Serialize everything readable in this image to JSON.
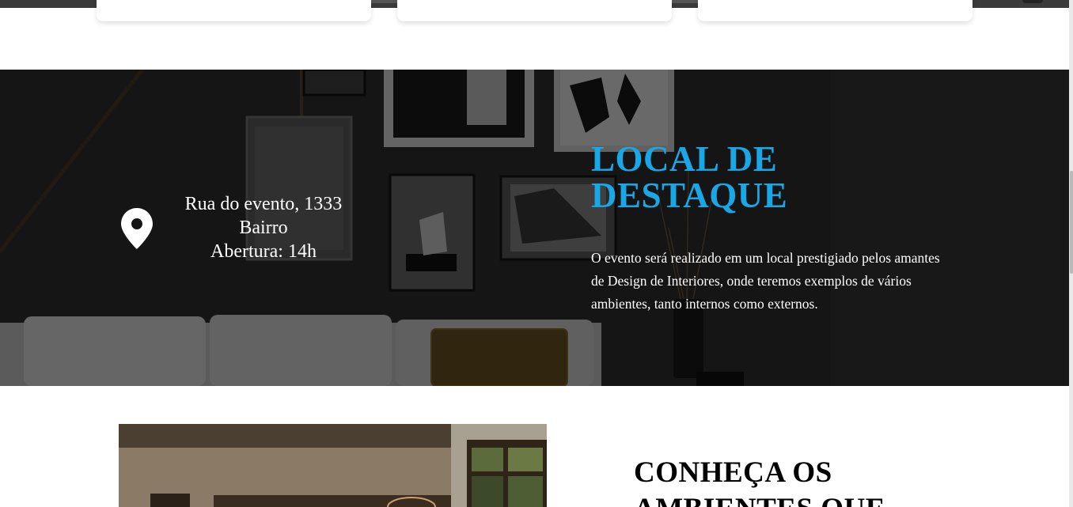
{
  "venue": {
    "address_lines": [
      "Rua do evento, 1333",
      "Bairro",
      "Abertura: 14h"
    ],
    "title_lines": [
      "LOCAL DE",
      "DESTAQUE"
    ],
    "description": "O evento será realizado em um local prestigiado pelos amantes de Design de Interiores, onde teremos exemplos de vários ambientes, tanto internos como externos.",
    "icon": "map-pin-icon",
    "accent_color": "#1aa7e6"
  },
  "environments": {
    "title_lines": [
      "CONHEÇA OS",
      "AMBIENTES QUE"
    ]
  }
}
